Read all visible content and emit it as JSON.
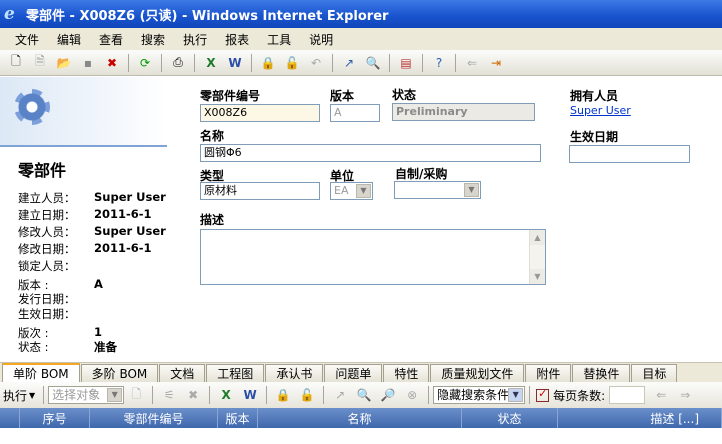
{
  "window": {
    "title": "零部件 - X008Z6 (只读) - Windows Internet Explorer"
  },
  "menu": [
    "文件",
    "编辑",
    "查看",
    "搜索",
    "执行",
    "报表",
    "工具",
    "说明"
  ],
  "toolbar_icons": [
    "new-icon",
    "preview-icon",
    "open-icon",
    "save-icon",
    "delete-icon",
    "refresh-icon",
    "print-icon",
    "excel-icon",
    "word-icon",
    "lock-icon",
    "unlock-icon",
    "undo-icon",
    "promote-icon",
    "search-doc-icon",
    "report-icon",
    "help-icon",
    "claim-icon",
    "exit-icon"
  ],
  "left": {
    "title": "零部件",
    "rows": [
      {
        "k": "建立人员：",
        "v": "Super User"
      },
      {
        "k": "建立日期：",
        "v": "2011-6-1"
      },
      {
        "k": "修改人员：",
        "v": "Super User"
      },
      {
        "k": "修改日期：",
        "v": "2011-6-1"
      },
      {
        "k": "锁定人员：",
        "v": ""
      },
      {
        "k": "版本  :",
        "v": "A"
      },
      {
        "k": "发行日期：",
        "v": ""
      },
      {
        "k": "生效日期：",
        "v": ""
      },
      {
        "k": "版次  :",
        "v": "1"
      },
      {
        "k": "状态  :",
        "v": "准备"
      }
    ]
  },
  "form": {
    "part_no_label": "零部件编号",
    "part_no": "X008Z6",
    "version_label": "版本",
    "version": "A",
    "state_label": "状态",
    "state": "Preliminary",
    "owner_label": "拥有人员",
    "owner": "Super User",
    "name_label": "名称",
    "name": "圆钢Φ6",
    "effective_label": "生效日期",
    "effective": "",
    "type_label": "类型",
    "type": "原材料",
    "unit_label": "单位",
    "unit": "EA",
    "make_buy_label": "自制/采购",
    "make_buy": "",
    "desc_label": "描述",
    "desc": ""
  },
  "tabs": [
    "单阶 BOM",
    "多阶 BOM",
    "文档",
    "工程图",
    "承认书",
    "问题单",
    "特性",
    "质量规划文件",
    "附件",
    "替换件",
    "目标"
  ],
  "active_tab": 0,
  "subtoolbar": {
    "execute": "执行",
    "select_object": "选择对象",
    "hide_search": "隐藏搜索条件",
    "per_page_label": "每页条数:"
  },
  "grid": {
    "columns": [
      "序号",
      "零部件编号",
      "版本",
      "名称",
      "状态",
      "描述 [...]"
    ]
  }
}
